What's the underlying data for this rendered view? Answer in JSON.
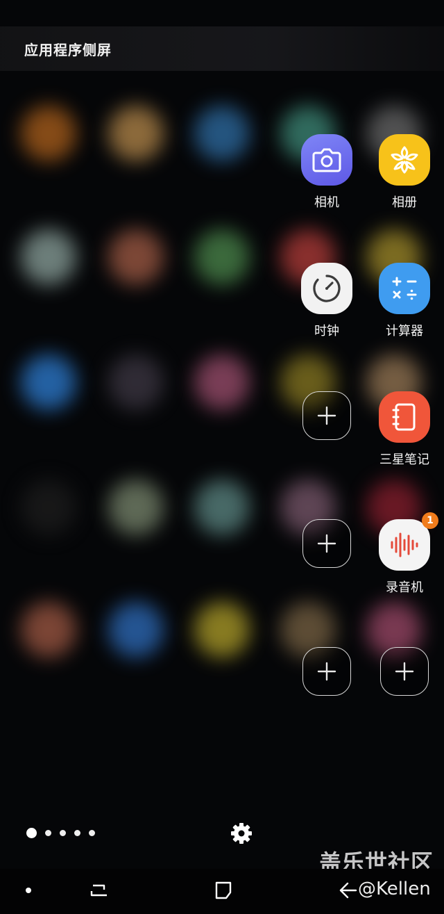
{
  "panel": {
    "title": "应用程序侧屏"
  },
  "apps": [
    {
      "label": "相机",
      "icon": "camera-icon"
    },
    {
      "label": "相册",
      "icon": "gallery-flower-icon"
    },
    {
      "label": "时钟",
      "icon": "clock-icon"
    },
    {
      "label": "计算器",
      "icon": "calculator-icon"
    },
    {
      "label": "三星笔记",
      "icon": "notes-icon"
    },
    {
      "label": "录音机",
      "icon": "voice-recorder-icon",
      "badge": "1"
    }
  ],
  "add_slots": 4,
  "pagination": {
    "pages": 5,
    "current": 1
  },
  "watermark": "盖乐世社区",
  "credit": "@Kellen",
  "colors": {
    "camera": "#6e6ff0",
    "gallery": "#f7c21a",
    "clock": "#f2f2f2",
    "calculator": "#3f9cf0",
    "notes": "#f0563a",
    "recorder": "#f4f4f4",
    "badge": "#f07c1c"
  }
}
